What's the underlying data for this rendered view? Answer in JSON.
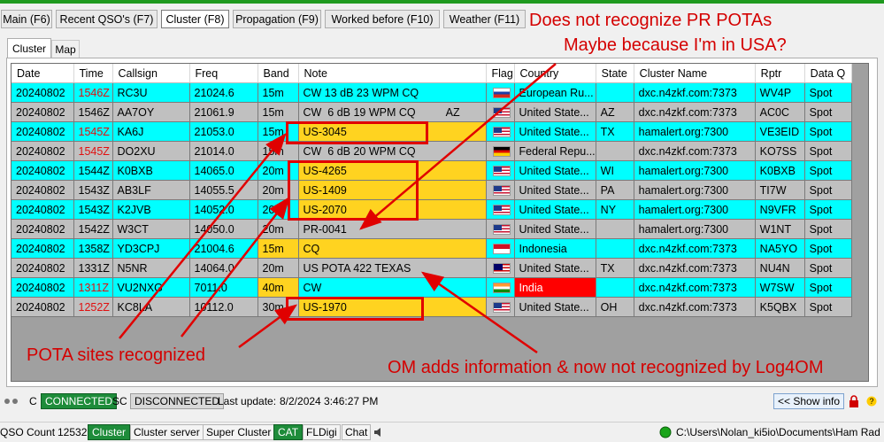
{
  "main_tabs": [
    "Main (F6)",
    "Recent QSO's (F7)",
    "Cluster (F8)",
    "Propagation (F9)",
    "Worked before (F10)",
    "Weather (F11)"
  ],
  "sub_tabs": [
    "Cluster",
    "Map"
  ],
  "columns": [
    "Date",
    "Time",
    "Callsign",
    "Freq",
    "Band",
    "Note",
    "Flag",
    "Country",
    "State",
    "Cluster Name",
    "Rptr",
    "Data Q"
  ],
  "rows": [
    {
      "date": "20240802",
      "time": "1546Z",
      "time_red": true,
      "call": "RC3U",
      "freq": "21024.6",
      "band": "15m",
      "band_y": false,
      "note": "CW 13 dB 23 WPM CQ",
      "note_y": false,
      "flag": "ru",
      "country": "European Ru...",
      "country_red": false,
      "state": "",
      "cluster": "dxc.n4zkf.com:7373",
      "rptr": "WV4P",
      "dataq": "Spot",
      "color": "cyan"
    },
    {
      "date": "20240802",
      "time": "1546Z",
      "time_red": false,
      "call": "AA7OY",
      "freq": "21061.9",
      "band": "15m",
      "band_y": false,
      "note": "CW  6 dB 19 WPM CQ          AZ",
      "note_y": false,
      "flag": "us",
      "country": "United State...",
      "country_red": false,
      "state": "AZ",
      "cluster": "dxc.n4zkf.com:7373",
      "rptr": "AC0C",
      "dataq": "Spot",
      "color": "gray"
    },
    {
      "date": "20240802",
      "time": "1545Z",
      "time_red": true,
      "call": "KA6J",
      "freq": "21053.0",
      "band": "15m",
      "band_y": false,
      "note": "US-3045",
      "note_y": true,
      "flag": "us",
      "country": "United State...",
      "country_red": false,
      "state": "TX",
      "cluster": "hamalert.org:7300",
      "rptr": "VE3EID",
      "dataq": "Spot",
      "color": "cyan"
    },
    {
      "date": "20240802",
      "time": "1545Z",
      "time_red": true,
      "call": "DO2XU",
      "freq": "21014.0",
      "band": "15m",
      "band_y": false,
      "note": "CW  6 dB 20 WPM CQ",
      "note_y": false,
      "flag": "de",
      "country": "Federal Repu...",
      "country_red": false,
      "state": "",
      "cluster": "dxc.n4zkf.com:7373",
      "rptr": "KO7SS",
      "dataq": "Spot",
      "color": "gray"
    },
    {
      "date": "20240802",
      "time": "1544Z",
      "time_red": false,
      "call": "K0BXB",
      "freq": "14065.0",
      "band": "20m",
      "band_y": false,
      "note": "US-4265",
      "note_y": true,
      "flag": "us",
      "country": "United State...",
      "country_red": false,
      "state": "WI",
      "cluster": "hamalert.org:7300",
      "rptr": "K0BXB",
      "dataq": "Spot",
      "color": "cyan"
    },
    {
      "date": "20240802",
      "time": "1543Z",
      "time_red": false,
      "call": "AB3LF",
      "freq": "14055.5",
      "band": "20m",
      "band_y": false,
      "note": "US-1409",
      "note_y": true,
      "flag": "us",
      "country": "United State...",
      "country_red": false,
      "state": "PA",
      "cluster": "hamalert.org:7300",
      "rptr": "TI7W",
      "dataq": "Spot",
      "color": "gray"
    },
    {
      "date": "20240802",
      "time": "1543Z",
      "time_red": false,
      "call": "K2JVB",
      "freq": "14052.0",
      "band": "20m",
      "band_y": false,
      "note": "US-2070",
      "note_y": true,
      "flag": "us",
      "country": "United State...",
      "country_red": false,
      "state": "NY",
      "cluster": "hamalert.org:7300",
      "rptr": "N9VFR",
      "dataq": "Spot",
      "color": "cyan"
    },
    {
      "date": "20240802",
      "time": "1542Z",
      "time_red": false,
      "call": "W3CT",
      "freq": "14050.0",
      "band": "20m",
      "band_y": false,
      "note": "PR-0041",
      "note_y": false,
      "flag": "us",
      "country": "United State...",
      "country_red": false,
      "state": "",
      "cluster": "hamalert.org:7300",
      "rptr": "W1NT",
      "dataq": "Spot",
      "color": "gray"
    },
    {
      "date": "20240802",
      "time": "1358Z",
      "time_red": false,
      "call": "YD3CPJ",
      "freq": "21004.6",
      "band": "15m",
      "band_y": true,
      "note": "CQ",
      "note_y": true,
      "flag": "id",
      "country": "Indonesia",
      "country_red": false,
      "state": "",
      "cluster": "dxc.n4zkf.com:7373",
      "rptr": "NA5YO",
      "dataq": "Spot",
      "color": "cyan"
    },
    {
      "date": "20240802",
      "time": "1331Z",
      "time_red": false,
      "call": "N5NR",
      "freq": "14064.0",
      "band": "20m",
      "band_y": false,
      "note": "US POTA 422 TEXAS",
      "note_y": false,
      "flag": "my",
      "country": "United State...",
      "country_red": false,
      "state": "TX",
      "cluster": "dxc.n4zkf.com:7373",
      "rptr": "NU4N",
      "dataq": "Spot",
      "color": "gray"
    },
    {
      "date": "20240802",
      "time": "1311Z",
      "time_red": true,
      "call": "VU2NXG",
      "freq": "7011.0",
      "band": "40m",
      "band_y": true,
      "note": "CW",
      "note_y": false,
      "flag": "in",
      "country": "India",
      "country_red": true,
      "state": "",
      "cluster": "dxc.n4zkf.com:7373",
      "rptr": "W7SW",
      "dataq": "Spot",
      "color": "cyan"
    },
    {
      "date": "20240802",
      "time": "1252Z",
      "time_red": true,
      "call": "KC8LA",
      "freq": "10112.0",
      "band": "30m",
      "band_y": false,
      "note": "US-1970",
      "note_y": true,
      "flag": "us",
      "country": "United State...",
      "country_red": false,
      "state": "OH",
      "cluster": "dxc.n4zkf.com:7373",
      "rptr": "K5QBX",
      "dataq": "Spot",
      "color": "gray"
    }
  ],
  "annotations": {
    "top1": "Does not recognize PR POTAs",
    "top2": "Maybe because I'm in USA?",
    "left": "POTA sites recognized",
    "right": "OM adds information & now not recognized by Log4OM"
  },
  "status1": {
    "c_label": "C",
    "connected": "CONNECTED",
    "sc_label": "SC",
    "disconnected": "DISCONNECTED",
    "last_update_label": "Last update:",
    "last_update": "8/2/2024 3:46:27 PM",
    "show_info": "<< Show info"
  },
  "status2": {
    "qso_count_label": "QSO Count",
    "qso_count": "12532",
    "cluster": "Cluster",
    "cluster_server": "Cluster server",
    "super_cluster": "Super Cluster",
    "cat": "CAT",
    "fldigi": "FLDigi",
    "chat": "Chat",
    "path": "C:\\Users\\Nolan_ki5io\\Documents\\Ham Rad"
  },
  "colors": {
    "cyan": "#00ffff",
    "gray": "#c0c0c0",
    "yellow": "#ffd320",
    "annotation_red": "#e00000",
    "connected_green": "#1e8c3a"
  }
}
